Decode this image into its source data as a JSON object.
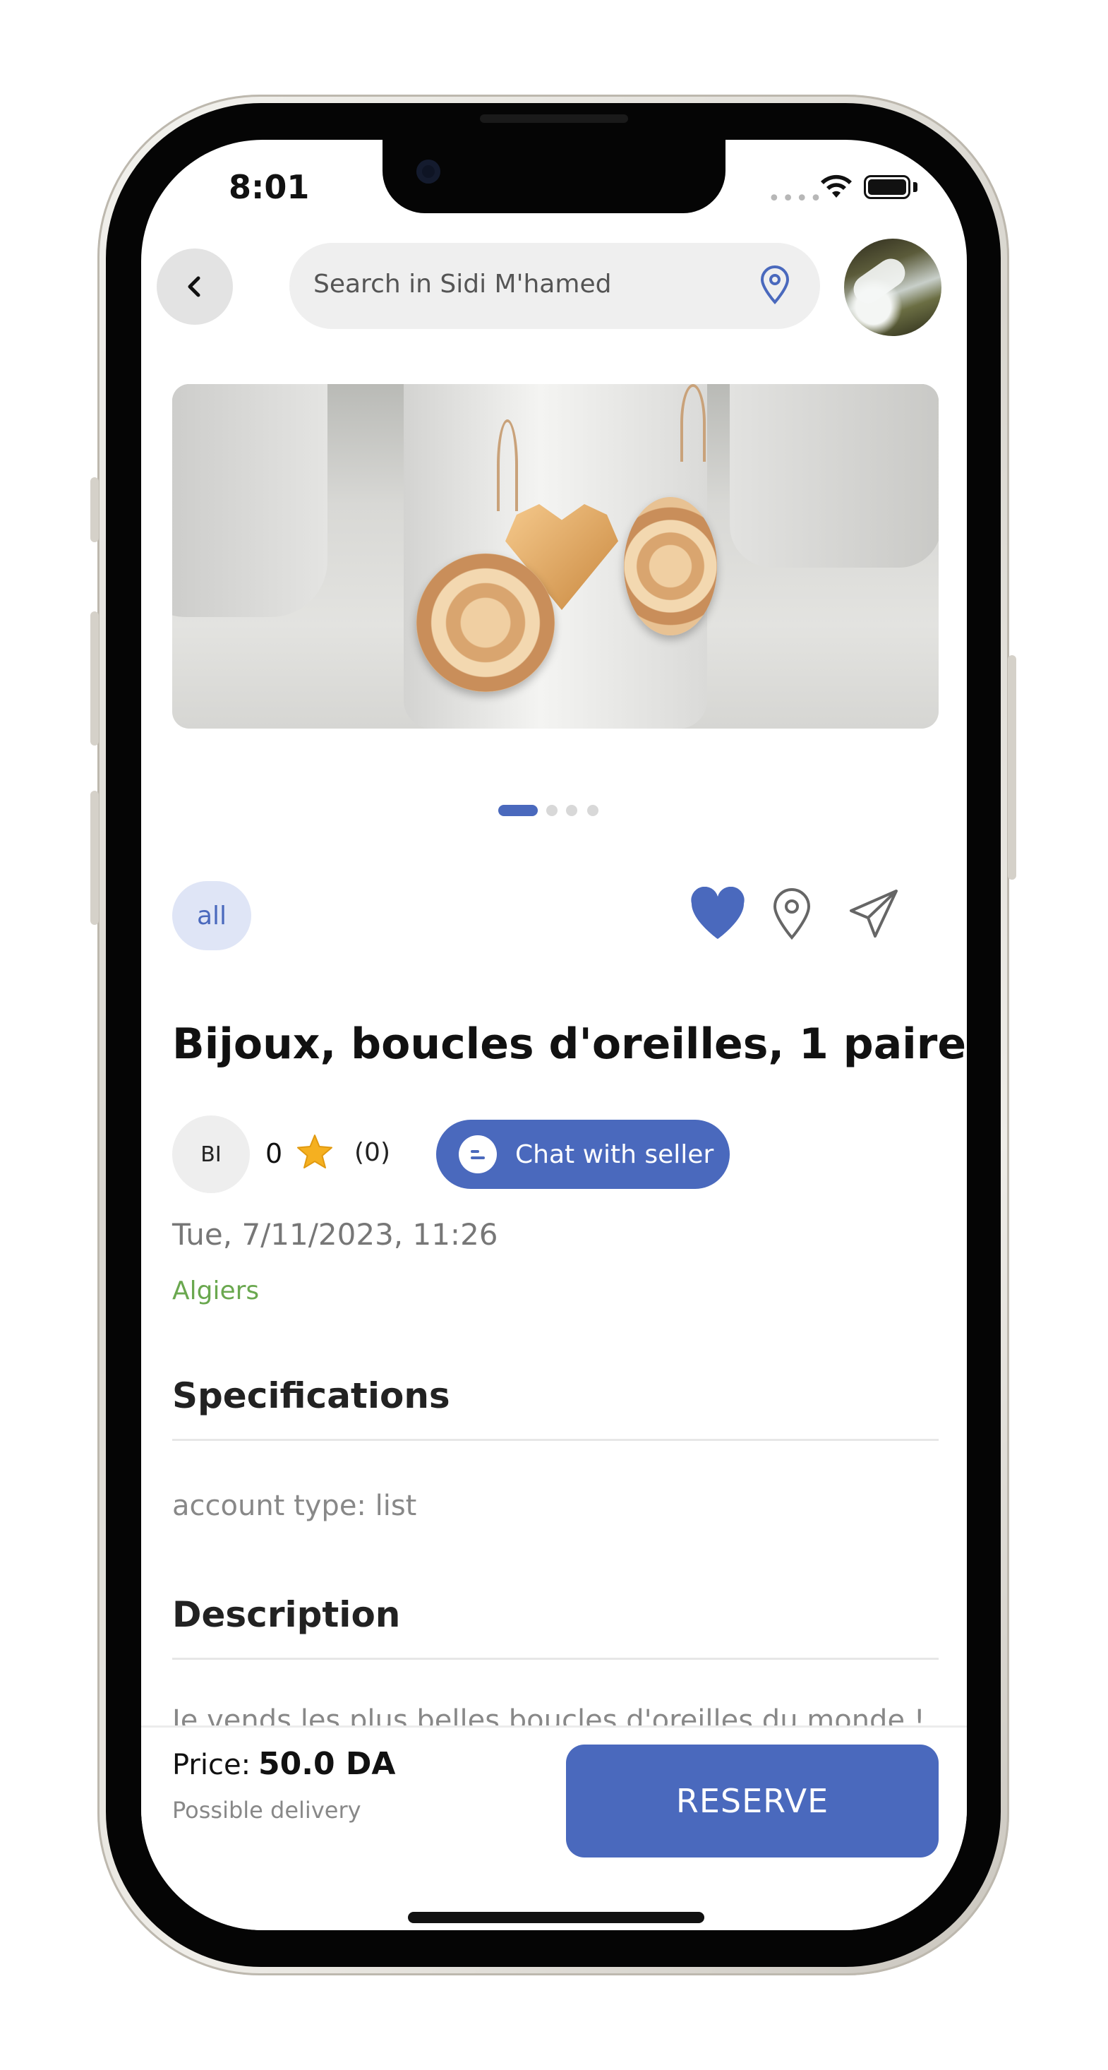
{
  "status_bar": {
    "time": "8:01",
    "signal_dots": "••••"
  },
  "header": {
    "search_placeholder": "Search in Sidi M'hamed"
  },
  "gallery": {
    "image_count": 4,
    "active_index": 0
  },
  "category_chip": "all",
  "product": {
    "title": "Bijoux, boucles d'oreilles, 1 paire",
    "date": "Tue, 7/11/2023, 11:26",
    "city": "Algiers",
    "description_preview": "Je vends les plus belles boucles d'oreilles du monde !"
  },
  "seller": {
    "initials": "BI",
    "rating": "0",
    "rating_count": "(0)",
    "chat_label": "Chat with seller"
  },
  "sections": {
    "specifications_title": "Specifications",
    "spec_line": "account type: list",
    "description_title": "Description"
  },
  "bottom_bar": {
    "price_label": "Price:",
    "price_value": "50.0 DA",
    "delivery": "Possible delivery",
    "reserve_label": "RESERVE"
  },
  "icons": {
    "back": "chevron-left-icon",
    "location": "map-pin-icon",
    "favorite": "heart-icon",
    "share": "paper-plane-icon",
    "star": "star-icon"
  },
  "colors": {
    "accent": "#4a69bd",
    "chip_bg": "#dfe5f6",
    "city": "#6aa84f",
    "star": "#f5b020"
  }
}
